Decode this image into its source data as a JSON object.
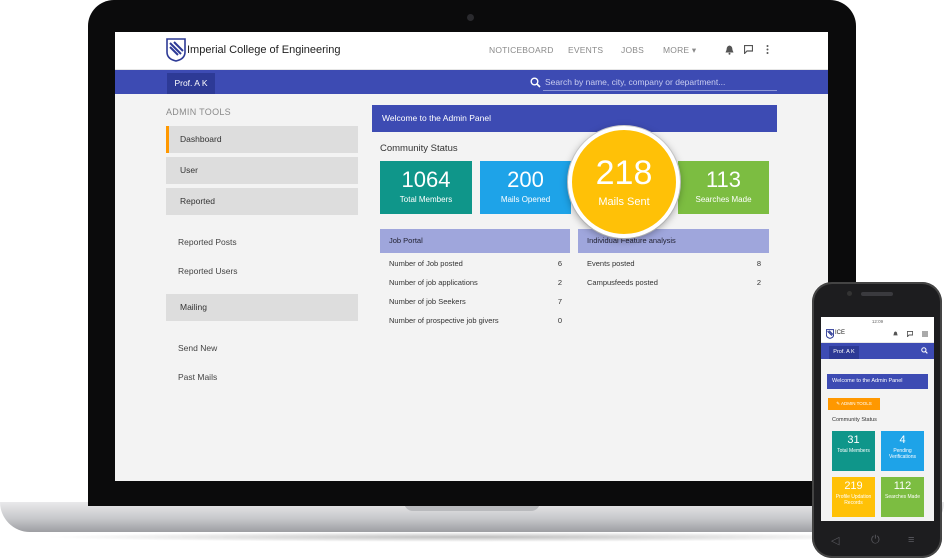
{
  "laptop": {
    "app": {
      "brand": "Imperial College of Engineering",
      "nav": {
        "noticeboard": "NOTICEBOARD",
        "events": "EVENTS",
        "jobs": "JOBS",
        "more": "MORE ▾"
      },
      "icons": [
        "bell-icon",
        "chat-icon",
        "more-vert-icon"
      ],
      "user_button": "Prof. A K",
      "search_placeholder": "Search by name, city, company or department...",
      "sidebar": {
        "heading": "ADMIN TOOLS",
        "menu": {
          "dashboard": "Dashboard",
          "user": "User",
          "reported": "Reported",
          "mailing": "Mailing"
        },
        "reported_sub": {
          "posts": "Reported Posts",
          "users": "Reported Users"
        },
        "mailing_sub": {
          "send_new": "Send New",
          "past": "Past Mails"
        }
      },
      "welcome": "Welcome to the Admin Panel",
      "community_status": "Community Status",
      "stats": [
        {
          "value": "1064",
          "label": "Total Members",
          "color": "#0f968a"
        },
        {
          "value": "200",
          "label": "Mails Opened",
          "color": "#1ea3e8"
        },
        {
          "value": "218",
          "label": "Mails Sent",
          "color": "#ffc107"
        },
        {
          "value": "113",
          "label": "Searches Made",
          "color": "#7cbd41"
        }
      ],
      "job_portal": {
        "title": "Job Portal",
        "rows": [
          {
            "label": "Number of Job posted",
            "value": "6"
          },
          {
            "label": "Number of job applications",
            "value": "2"
          },
          {
            "label": "Number of job Seekers",
            "value": "7"
          },
          {
            "label": "Number of prospective job givers",
            "value": "0"
          }
        ]
      },
      "feature_analysis": {
        "title": "Individual Feature analysis",
        "rows": [
          {
            "label": "Events posted",
            "value": "8"
          },
          {
            "label": "Campusfeeds posted",
            "value": "2"
          }
        ]
      }
    }
  },
  "phone": {
    "status_time": "12:09",
    "brand": "ICE",
    "user_button": "Prof. A K",
    "welcome": "Welcome to the Admin Panel",
    "admin_tools": "ADMIN TOOLS",
    "community_status": "Community Status",
    "stats": [
      {
        "value": "31",
        "label": "Total Members",
        "color": "#0f968a"
      },
      {
        "value": "4",
        "label": "Pending Verifications",
        "color": "#1ea3e8"
      },
      {
        "value": "219",
        "label": "Profile Updation Records",
        "color": "#ffc107"
      },
      {
        "value": "112",
        "label": "Searches Made",
        "color": "#7cbd41"
      }
    ]
  }
}
